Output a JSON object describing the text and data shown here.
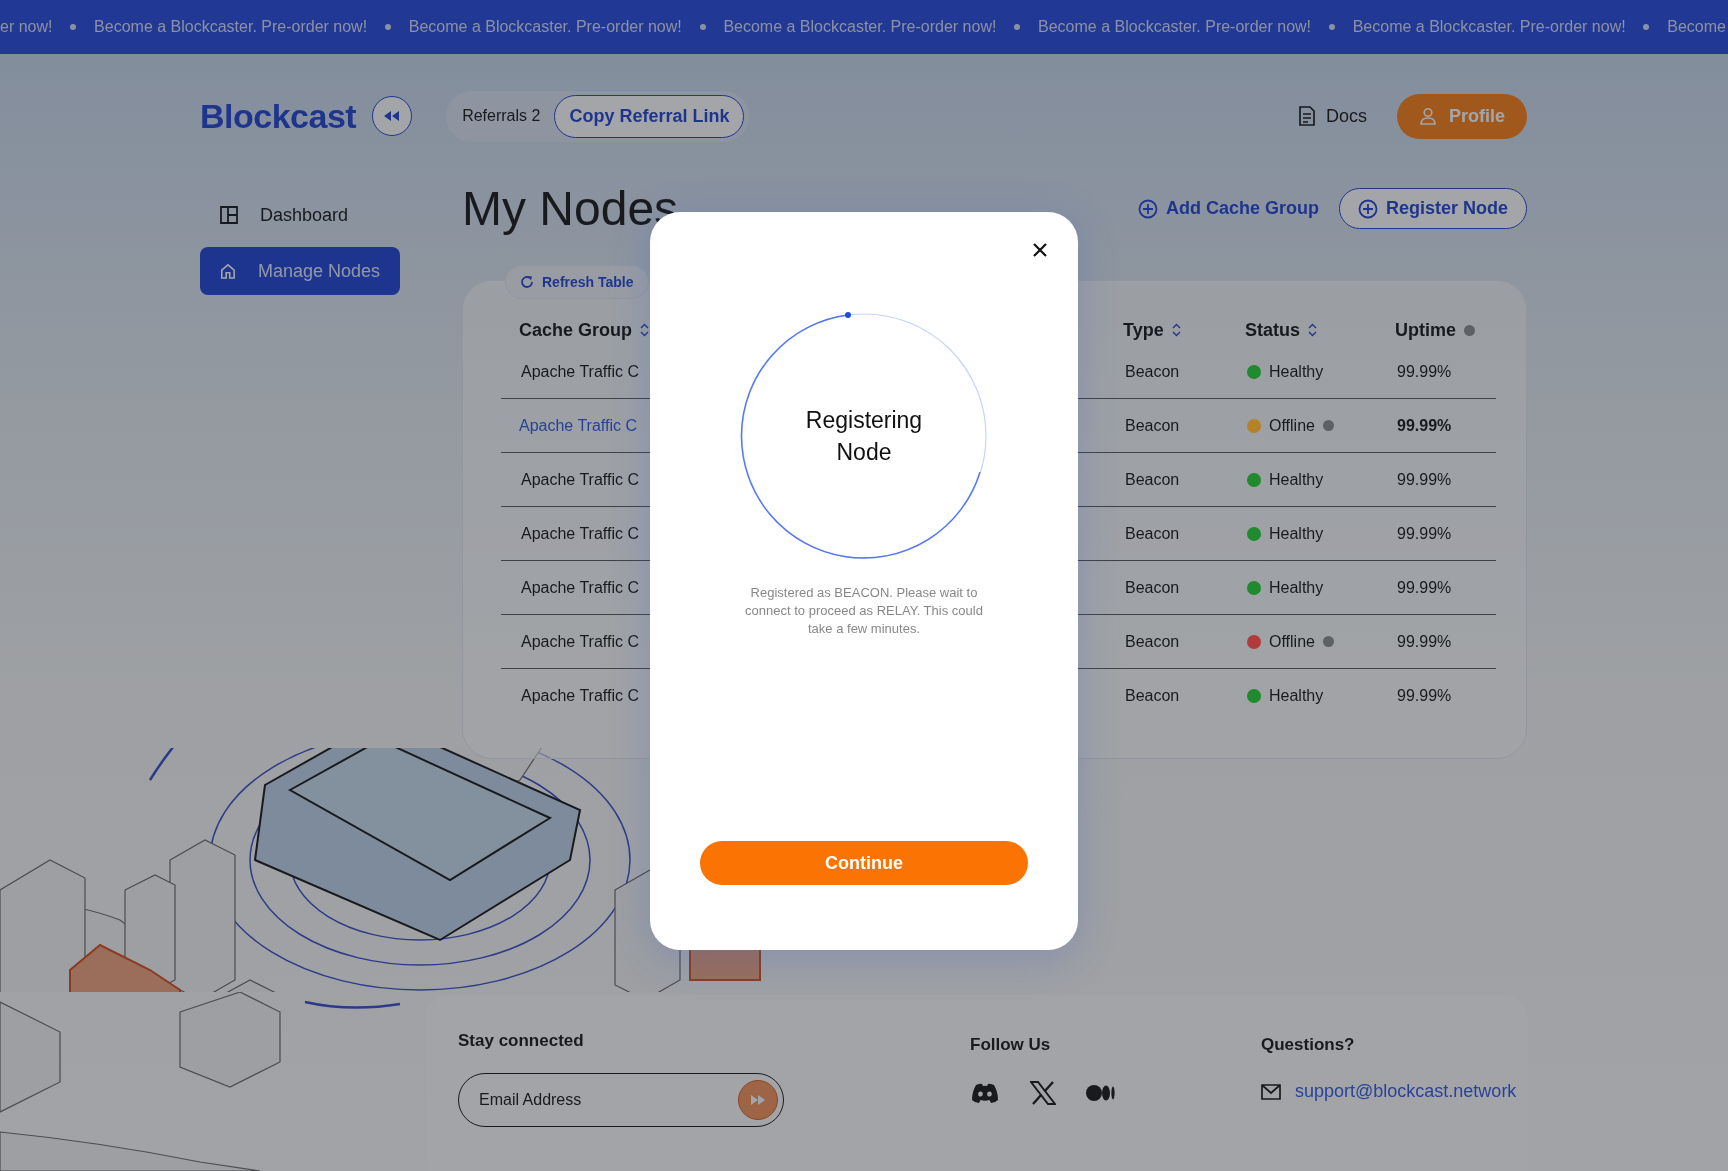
{
  "banner": {
    "items": [
      "er now!",
      "Become a Blockcaster. Pre-order now!",
      "Become a Blockcaster. Pre-order now!",
      "Become a Blockcaster. Pre-order now!",
      "Become a Blockcaster. Pre-order now!",
      "Become a Blockcaster. Pre-order now!",
      "Become"
    ]
  },
  "header": {
    "logo": "Blockcast",
    "referrals": "Referrals 2",
    "copy_link": "Copy Referral Link",
    "docs": "Docs",
    "profile": "Profile"
  },
  "sidebar": {
    "items": [
      {
        "label": "Dashboard",
        "selected": false
      },
      {
        "label": "Manage Nodes",
        "selected": true
      }
    ]
  },
  "page": {
    "title": "My Nodes",
    "add_group": "Add Cache Group",
    "register": "Register Node"
  },
  "table": {
    "refresh": "Refresh Table",
    "columns": [
      {
        "label": "Cache Group",
        "sortable": true,
        "info": false
      },
      {
        "label": "Type",
        "sortable": true,
        "info": false
      },
      {
        "label": "Status",
        "sortable": true,
        "info": false
      },
      {
        "label": "Uptime",
        "sortable": false,
        "info": true
      }
    ],
    "rows": [
      {
        "cache_group": "Apache Traffic C",
        "type": "Beacon",
        "status": "Healthy",
        "color": "#1f8a2e",
        "info": false,
        "uptime": "99.99%",
        "selected": false
      },
      {
        "cache_group": "Apache Traffic C",
        "type": "Beacon",
        "status": "Offline",
        "color": "#b5822a",
        "info": true,
        "uptime": "99.99%",
        "selected": true
      },
      {
        "cache_group": "Apache Traffic C",
        "type": "Beacon",
        "status": "Healthy",
        "color": "#1f8a2e",
        "info": false,
        "uptime": "99.99%",
        "selected": false
      },
      {
        "cache_group": "Apache Traffic C",
        "type": "Beacon",
        "status": "Healthy",
        "color": "#1f8a2e",
        "info": false,
        "uptime": "99.99%",
        "selected": false
      },
      {
        "cache_group": "Apache Traffic C",
        "type": "Beacon",
        "status": "Healthy",
        "color": "#1f8a2e",
        "info": false,
        "uptime": "99.99%",
        "selected": false
      },
      {
        "cache_group": "Apache Traffic C",
        "type": "Beacon",
        "status": "Offline",
        "color": "#b33a3a",
        "info": true,
        "uptime": "99.99%",
        "selected": false
      },
      {
        "cache_group": "Apache Traffic C",
        "type": "Beacon",
        "status": "Healthy",
        "color": "#1f8a2e",
        "info": false,
        "uptime": "99.99%",
        "selected": false
      }
    ]
  },
  "footer": {
    "stay_connected": "Stay connected",
    "email_placeholder": "Email Address",
    "follow_us": "Follow Us",
    "questions": "Questions?",
    "support_email": "support@blockcast.network"
  },
  "modal": {
    "title": "Registering Node",
    "message": "Registered as BEACON. Please wait to connect to proceed as RELAY. This could take a few minutes.",
    "button": "Continue"
  }
}
